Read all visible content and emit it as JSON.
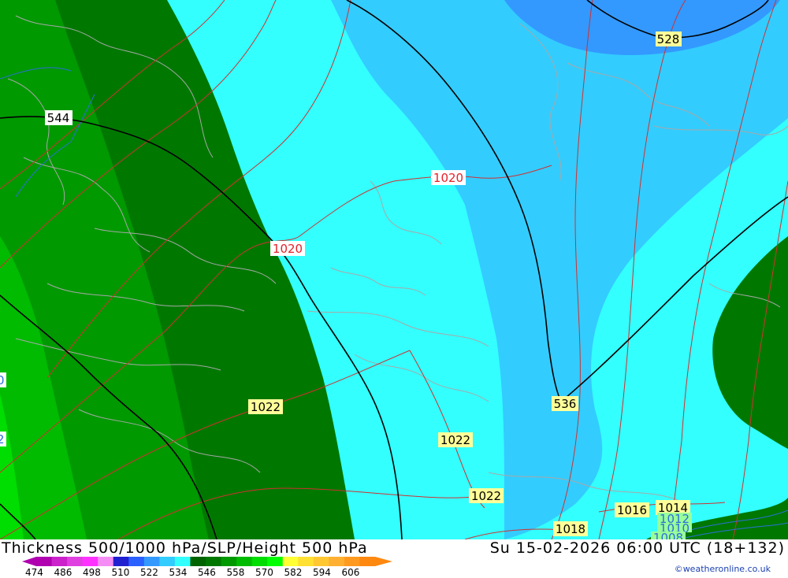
{
  "title": "Thickness 500/1000 hPa/SLP/Height 500 hPa",
  "datetime": "Su 15-02-2026 06:00 UTC (18+132)",
  "credit": "©weatheronline.co.uk",
  "colors": {
    "band_522": "#33ffff",
    "band_516": "#33ccff",
    "band_510": "#3399ff",
    "band_534": "#007800",
    "band_540": "#009900",
    "band_546": "#00bb00",
    "band_552": "#00dd00",
    "slp_isobar": "#d03030",
    "height_contour": "#000000",
    "coastline": "#a8a8a8"
  },
  "height_labels": [
    "528",
    "544",
    "536"
  ],
  "slp_labels": {
    "red": [
      "1020",
      "1020"
    ],
    "yellow": [
      "1022",
      "1022",
      "1022",
      "1018",
      "1016",
      "1014"
    ],
    "green": [
      "1012",
      "1010",
      "1008"
    ]
  },
  "edge_fragments": [
    "0",
    "2"
  ],
  "scale": {
    "colors": [
      "#b000b0",
      "#cc22cc",
      "#e040e0",
      "#ff33ff",
      "#f48ef4",
      "#2020d0",
      "#2a60ff",
      "#3399ff",
      "#33ccff",
      "#33ffff",
      "#006400",
      "#007800",
      "#009900",
      "#00bb00",
      "#00dd00",
      "#00ff00",
      "#ffff33",
      "#ffe033",
      "#ffc833",
      "#ffb033",
      "#ff9a20",
      "#ff8810"
    ],
    "labels": [
      "474",
      "486",
      "498",
      "510",
      "522",
      "534",
      "546",
      "558",
      "570",
      "582",
      "594",
      "606"
    ]
  }
}
